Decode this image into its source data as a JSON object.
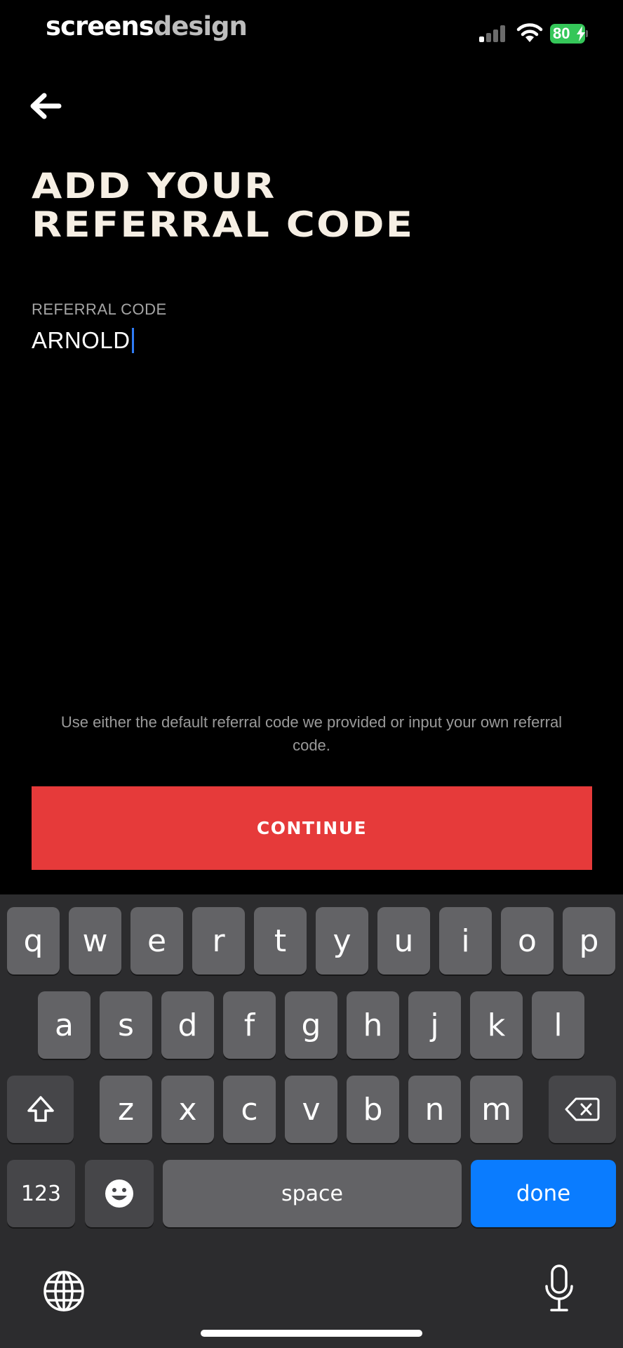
{
  "status_bar": {
    "watermark_part1": "screens",
    "watermark_part2": "design",
    "battery_level": "80"
  },
  "header": {
    "title_line1": "ADD YOUR",
    "title_line2": "REFERRAL CODE"
  },
  "form": {
    "field_label": "REFERRAL CODE",
    "field_value": "ARNOLD",
    "helper_text": "Use either the default referral code we provided or input your own referral code.",
    "continue_label": "CONTINUE"
  },
  "keyboard": {
    "row1": [
      "q",
      "w",
      "e",
      "r",
      "t",
      "y",
      "u",
      "i",
      "o",
      "p"
    ],
    "row2": [
      "a",
      "s",
      "d",
      "f",
      "g",
      "h",
      "j",
      "k",
      "l"
    ],
    "row3": [
      "z",
      "x",
      "c",
      "v",
      "b",
      "n",
      "m"
    ],
    "numbers_label": "123",
    "space_label": "space",
    "done_label": "done"
  },
  "colors": {
    "background": "#000000",
    "accent_button": "#e63a3a",
    "title_text": "#f6efe4",
    "done_key": "#0a7cff",
    "cursor": "#2f7cf6",
    "battery": "#35c759"
  }
}
